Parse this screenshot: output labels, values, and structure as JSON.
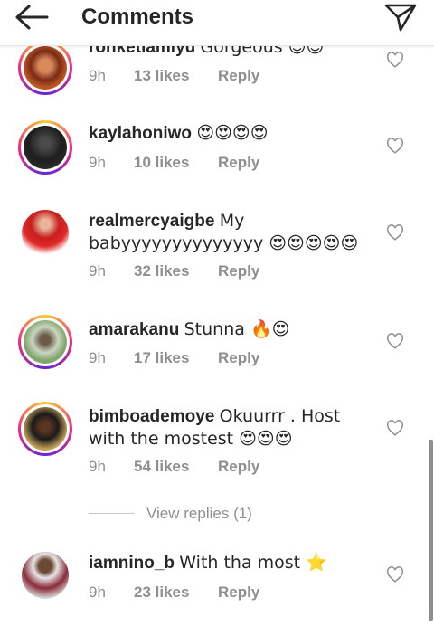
{
  "header": {
    "title": "Comments",
    "back_icon": "arrow-left-icon",
    "share_icon": "paper-plane-icon"
  },
  "comments": [
    {
      "username": "ronketiamiyu",
      "text": "Gorgeous 😍😍",
      "time": "9h",
      "likes": "13 likes",
      "reply": "Reply"
    },
    {
      "username": "kaylahoniwo",
      "text": "😍😍😍😍",
      "time": "9h",
      "likes": "10 likes",
      "reply": "Reply"
    },
    {
      "username": "realmercyaigbe",
      "text": "My babyyyyyyyyyyyyyy 😍😍😍😍😍",
      "time": "9h",
      "likes": "32 likes",
      "reply": "Reply"
    },
    {
      "username": "amarakanu",
      "text": "Stunna 🔥😍",
      "time": "9h",
      "likes": "17 likes",
      "reply": "Reply"
    },
    {
      "username": "bimboademoye",
      "text": "Okuurrr . Host with the mostest 😍😍😍",
      "time": "9h",
      "likes": "54 likes",
      "reply": "Reply"
    },
    {
      "username": "iamnino_b",
      "text": "With tha most ⭐",
      "time": "9h",
      "likes": "23 likes",
      "reply": "Reply"
    }
  ],
  "view_replies": "View replies (1)",
  "colors": {
    "accent_gradient": [
      "#f9ce34",
      "#ee2a7b",
      "#6228d7"
    ],
    "meta_gray": "#8e8e8e",
    "text": "#262626"
  }
}
